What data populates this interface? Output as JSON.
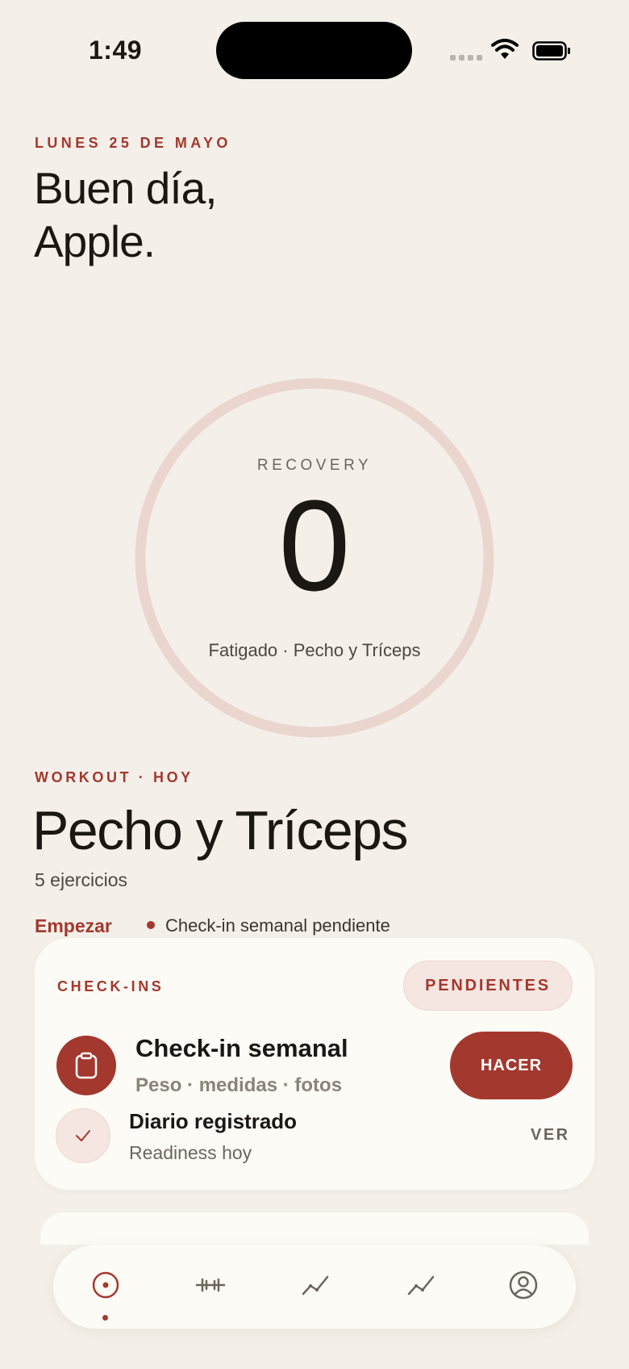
{
  "status_bar": {
    "time": "1:49"
  },
  "header": {
    "date": "LUNES 25 DE MAYO",
    "greeting_line1": "Buen día,",
    "greeting_line2": "Apple."
  },
  "recovery": {
    "label": "RECOVERY",
    "value": "0",
    "percent": 0,
    "subtitle": "Fatigado · Pecho y Tríceps"
  },
  "workout": {
    "label": "WORKOUT · HOY",
    "title": "Pecho y Tríceps",
    "count": "5 ejercicios",
    "start_label": "Empezar",
    "pending_note": "Check-in semanal pendiente"
  },
  "checkins": {
    "label": "CHECK-INS",
    "badge": "PENDIENTES",
    "items": [
      {
        "title": "Check-in semanal",
        "subtitle": "Peso · medidas · fotos",
        "action": "HACER",
        "icon": "clipboard-icon"
      },
      {
        "title": "Diario registrado",
        "subtitle": "Readiness hoy",
        "action": "VER",
        "icon": "checkmark-icon"
      }
    ]
  },
  "tabbar": {
    "items": [
      {
        "icon": "home-pin-icon",
        "active": true
      },
      {
        "icon": "dumbbell-icon",
        "active": false
      },
      {
        "icon": "chart-line-icon",
        "active": false
      },
      {
        "icon": "trend-line-icon",
        "active": false
      },
      {
        "icon": "profile-icon",
        "active": false
      }
    ]
  },
  "colors": {
    "accent": "#a3382e",
    "background": "#f4f0e9",
    "card": "#fdfbf6",
    "ring_track": "#ead6cf",
    "badge_bg": "#f6e6e2"
  }
}
